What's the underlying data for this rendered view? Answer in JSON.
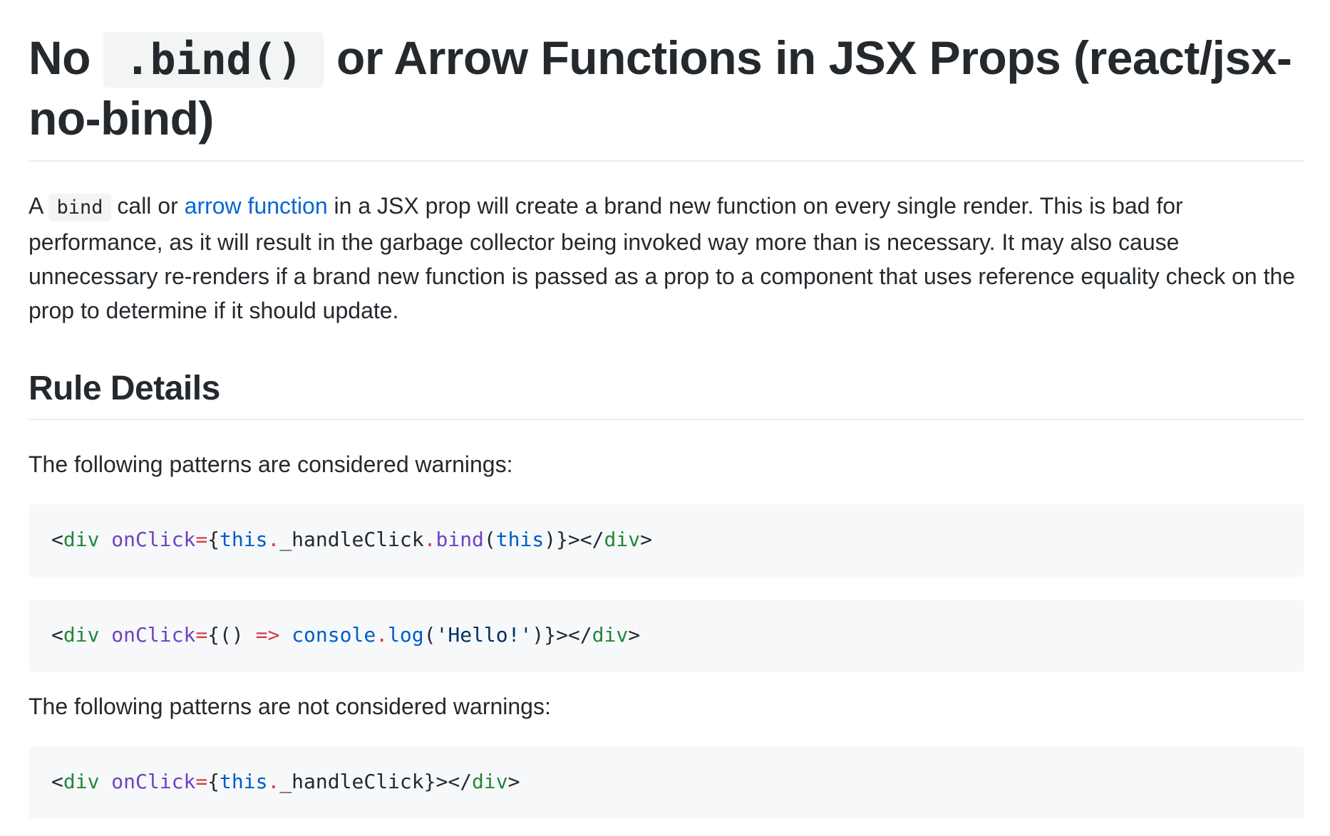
{
  "heading": {
    "prefix": "No",
    "code": ".bind()",
    "suffix": "or Arrow Functions in JSX Props (react/jsx-no-bind)"
  },
  "intro": {
    "start": "A",
    "code": "bind",
    "mid": "call or",
    "link_text": "arrow function",
    "rest": "in a JSX prop will create a brand new function on every single render. This is bad for performance, as it will result in the garbage collector being invoked way more than is necessary. It may also cause unnecessary re-renders if a brand new function is passed as a prop to a component that uses reference equality check on the prop to determine if it should update."
  },
  "section_title": "Rule Details",
  "warnings_text": "The following patterns are considered warnings:",
  "non_warnings_text": "The following patterns are not considered warnings:",
  "code_blocks": {
    "warn1": {
      "t1": "<",
      "t2": "div",
      "t3": " ",
      "t4": "onClick",
      "t5": "=",
      "t6": "{",
      "t7": "this",
      "t8": ".",
      "t9": "_handleClick",
      "t10": ".",
      "t11": "bind",
      "t12": "(",
      "t13": "this",
      "t14": ")}></",
      "t15": "div",
      "t16": ">"
    },
    "warn2": {
      "t1": "<",
      "t2": "div",
      "t3": " ",
      "t4": "onClick",
      "t5": "=",
      "t6": "{() ",
      "t7": "=>",
      "t8": " ",
      "t9": "console",
      "t10": ".",
      "t11": "log",
      "t12": "(",
      "t13": "'Hello!'",
      "t14": ")}></",
      "t15": "div",
      "t16": ">"
    },
    "ok1": {
      "t1": "<",
      "t2": "div",
      "t3": " ",
      "t4": "onClick",
      "t5": "=",
      "t6": "{",
      "t7": "this",
      "t8": ".",
      "t9": "_handleClick}></",
      "t10": "div",
      "t11": ">"
    }
  }
}
